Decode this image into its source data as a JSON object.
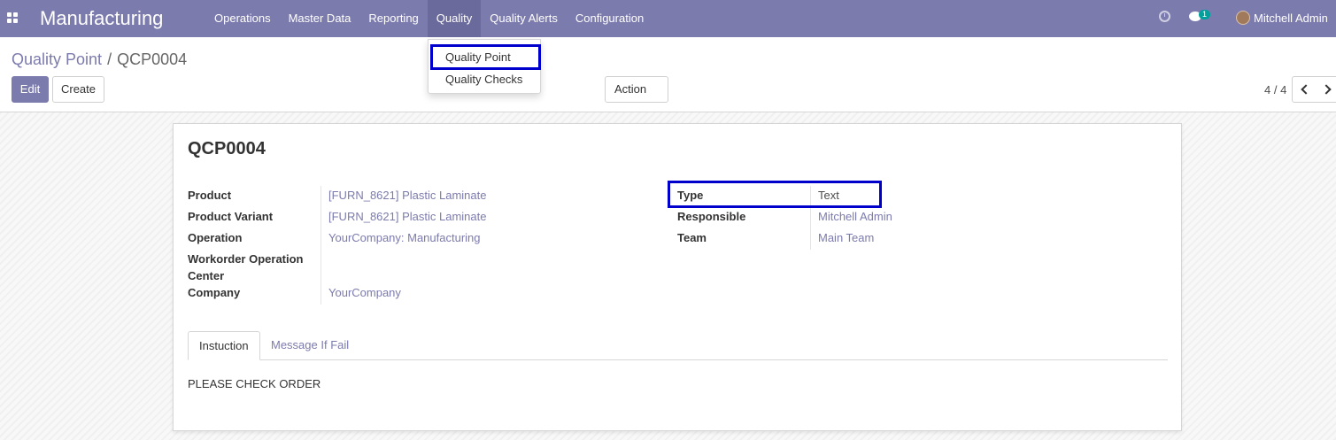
{
  "navbar": {
    "app_name": "Manufacturing",
    "menu": [
      {
        "label": "Operations"
      },
      {
        "label": "Master Data"
      },
      {
        "label": "Reporting"
      },
      {
        "label": "Quality"
      },
      {
        "label": "Quality Alerts"
      },
      {
        "label": "Configuration"
      }
    ],
    "active_menu": "Quality",
    "chat_badge": "1",
    "user_name": "Mitchell Admin",
    "icons": [
      "apps-icon",
      "clock-icon",
      "chat-icon",
      "avatar"
    ]
  },
  "quality_dropdown": {
    "items": [
      {
        "label": "Quality Point",
        "highlighted": true
      },
      {
        "label": "Quality Checks",
        "highlighted": false
      }
    ]
  },
  "breadcrumb": {
    "parent": "Quality Point",
    "separator": "/",
    "current": "QCP0004"
  },
  "toolbar": {
    "edit_label": "Edit",
    "create_label": "Create",
    "action_label": "Action"
  },
  "pager": {
    "value": "4 / 4"
  },
  "record": {
    "name": "QCP0004",
    "left_fields": [
      {
        "label": "Product",
        "value": "[FURN_8621] Plastic Laminate"
      },
      {
        "label": "Product Variant",
        "value": "[FURN_8621] Plastic Laminate"
      },
      {
        "label": "Operation",
        "value": "YourCompany: Manufacturing"
      },
      {
        "label_line1": "Workorder Operation",
        "label_line2": "Center",
        "value": ""
      },
      {
        "label": "Company",
        "value": "YourCompany"
      }
    ],
    "right_fields": [
      {
        "label": "Type",
        "value": "Text",
        "highlighted": true
      },
      {
        "label": "Responsible",
        "value": "Mitchell Admin"
      },
      {
        "label": "Team",
        "value": "Main Team"
      }
    ]
  },
  "tabs": [
    {
      "label": "Instuction",
      "active": true
    },
    {
      "label": "Message If Fail",
      "active": false
    }
  ],
  "tab_content": "PLEASE CHECK ORDER",
  "colors": {
    "brand": "#7c7bad",
    "highlight_box": "#0000cc",
    "badge": "#00a09d"
  }
}
